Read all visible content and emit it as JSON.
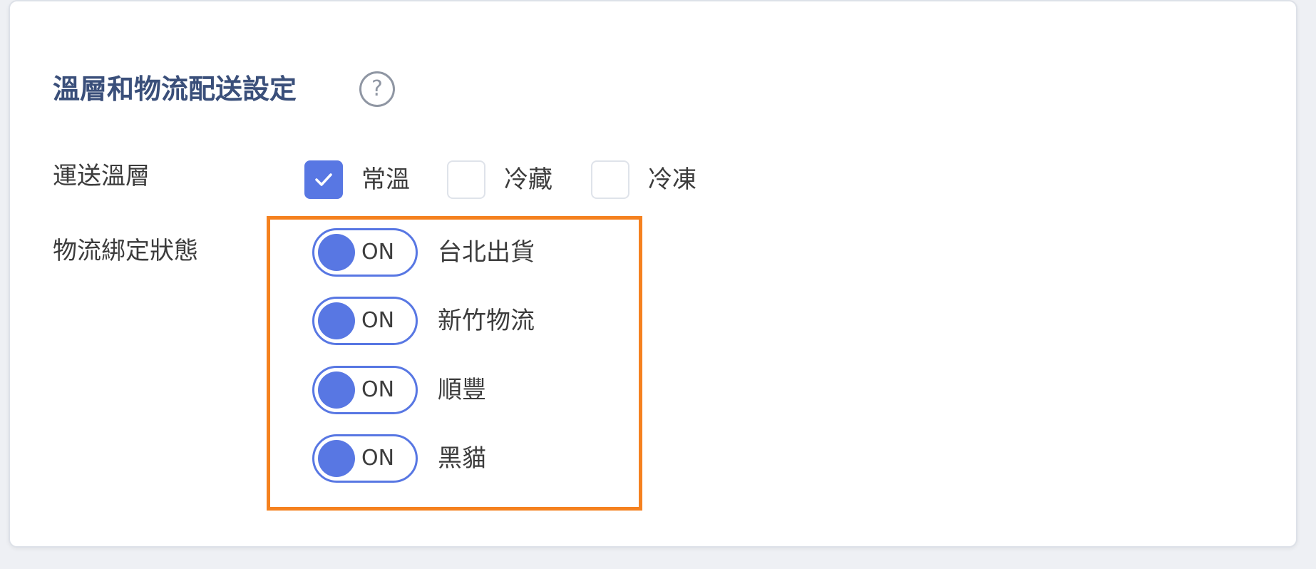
{
  "section": {
    "title": "溫層和物流配送設定",
    "help_glyph": "?"
  },
  "temperature": {
    "label": "運送溫層",
    "options": [
      {
        "label": "常溫",
        "checked": true
      },
      {
        "label": "冷藏",
        "checked": false
      },
      {
        "label": "冷凍",
        "checked": false
      }
    ]
  },
  "logistics": {
    "label": "物流綁定狀態",
    "carriers": [
      {
        "name": "台北出貨",
        "state": "ON"
      },
      {
        "name": "新竹物流",
        "state": "ON"
      },
      {
        "name": "順豐",
        "state": "ON"
      },
      {
        "name": "黑貓",
        "state": "ON"
      }
    ]
  },
  "colors": {
    "accent": "#5877e3",
    "title": "#3a4f7a",
    "highlight": "#f5811f"
  }
}
